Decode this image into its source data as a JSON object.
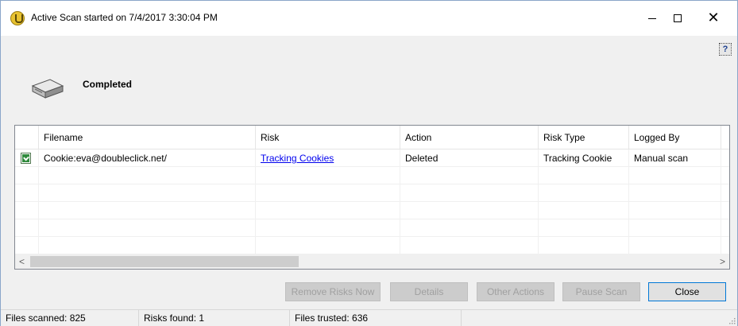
{
  "window": {
    "title": "Active Scan started on 7/4/2017 3:30:04 PM",
    "controls": {
      "minimize": "–",
      "maximize": "□",
      "close": "✕"
    }
  },
  "help": {
    "label": "?"
  },
  "status": {
    "text": "Completed"
  },
  "table": {
    "columns": [
      "Filename",
      "Risk",
      "Action",
      "Risk Type",
      "Logged By"
    ],
    "rows": [
      {
        "filename": "Cookie:eva@doubleclick.net/",
        "risk": "Tracking Cookies",
        "action": "Deleted",
        "risk_type": "Tracking Cookie",
        "logged_by": "Manual scan"
      }
    ]
  },
  "scrollbar": {
    "left_arrow": "<",
    "right_arrow": ">"
  },
  "buttons": {
    "remove_risks": "Remove Risks Now",
    "details": "Details",
    "other_actions": "Other Actions",
    "pause_scan": "Pause Scan",
    "close": "Close"
  },
  "statusbar": {
    "files_scanned": "Files scanned: 825",
    "risks_found": "Risks found: 1",
    "files_trusted": "Files trusted: 636"
  },
  "colors": {
    "link": "#0000ee",
    "disabled_text": "#a0a0a0",
    "default_button_border": "#0078d7"
  }
}
